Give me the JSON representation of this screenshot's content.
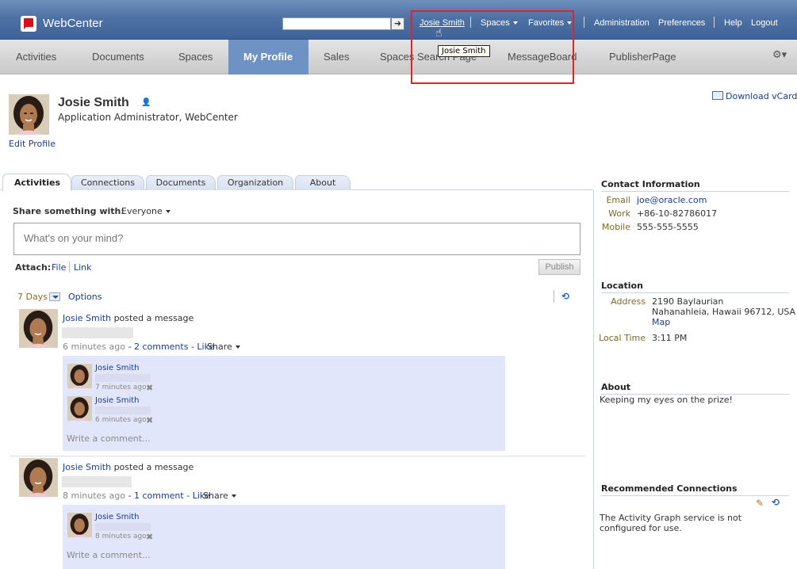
{
  "header": {
    "brand": "WebCenter",
    "search_value": "",
    "search_go": "➜",
    "links": {
      "user": "Josie Smith",
      "spaces": "Spaces",
      "favorites": "Favorites",
      "administration": "Administration",
      "preferences": "Preferences",
      "help": "Help",
      "logout": "Logout"
    },
    "tooltip": "Josie Smith"
  },
  "nav": {
    "items": [
      "Activities",
      "Documents",
      "Spaces",
      "My Profile",
      "Sales",
      "Spaces Search Page",
      "MessageBoard",
      "PublisherPage"
    ],
    "active": "My Profile"
  },
  "profile": {
    "name": "Josie Smith",
    "title": "Application Administrator, WebCenter",
    "edit_link": "Edit Profile",
    "vcard_link": "Download vCard"
  },
  "tabs": {
    "active": "Activities",
    "items": [
      "Connections",
      "Documents",
      "Organization",
      "About"
    ]
  },
  "composer": {
    "share_label": "Share something with:",
    "share_value": "Everyone",
    "placeholder": "What's on your mind?",
    "attach_label": "Attach:",
    "attach_file": "File",
    "attach_link": "Link",
    "publish": "Publish"
  },
  "filter": {
    "days": "7 Days",
    "options": "Options"
  },
  "posts": [
    {
      "author": "Josie Smith",
      "action": " posted a message",
      "time": "6 minutes ago",
      "dash": " - ",
      "comments": "2 comments",
      "like": "Like",
      "share": "Share",
      "replies": [
        {
          "author": "Josie Smith",
          "time": "7 minutes ago"
        },
        {
          "author": "Josie Smith",
          "time": "6 minutes ago"
        }
      ],
      "write_comment": "Write a comment..."
    },
    {
      "author": "Josie Smith",
      "action": " posted a message",
      "time": "8 minutes ago",
      "dash": " - ",
      "comments": "1 comment",
      "like": "Like",
      "share": "Share",
      "replies": [
        {
          "author": "Josie Smith",
          "time": "8 minutes ago"
        }
      ],
      "write_comment": "Write a comment..."
    }
  ],
  "contact": {
    "title": "Contact Information",
    "email_label": "Email",
    "email": "joe@oracle.com",
    "work_label": "Work",
    "work": "+86-10-82786017",
    "mobile_label": "Mobile",
    "mobile": "555-555-5555"
  },
  "location": {
    "title": "Location",
    "address_label": "Address",
    "address_line1": "2190 Baylaurian",
    "address_line2": "Nahanahleia, Hawaii 96712, USA",
    "map_link": "Map",
    "time_label": "Local Time",
    "time": "3:11 PM"
  },
  "about": {
    "title": "About",
    "text": "Keeping my eyes on the prize!"
  },
  "recommended": {
    "title": "Recommended Connections",
    "text": "The Activity Graph service is not configured for use."
  },
  "colors": {
    "header": "#4e72a5",
    "nav_active": "#6e92c3",
    "highlight": "#e0232a",
    "comment_bg": "#e2e6fa"
  }
}
